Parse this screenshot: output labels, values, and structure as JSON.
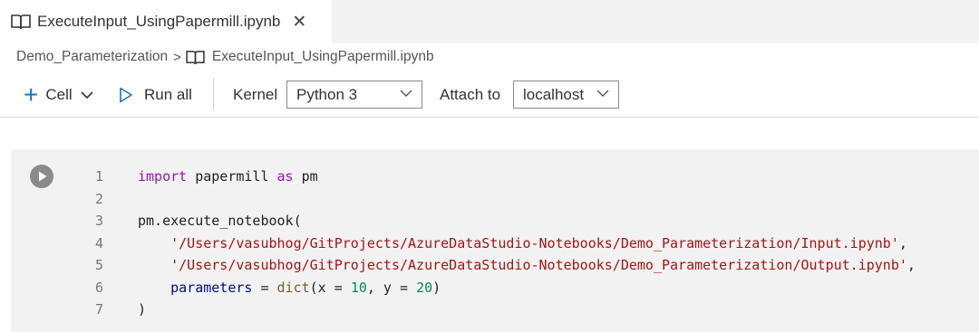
{
  "tab": {
    "title": "ExecuteInput_UsingPapermill.ipynb",
    "close_icon": "close-icon",
    "icon": "notebook-icon"
  },
  "breadcrumb": {
    "folder": "Demo_Parameterization",
    "separator": ">",
    "file": "ExecuteInput_UsingPapermill.ipynb"
  },
  "toolbar": {
    "cell_label": "Cell",
    "run_all_label": "Run all",
    "kernel_label": "Kernel",
    "kernel_value": "Python 3",
    "attach_label": "Attach to",
    "attach_value": "localhost"
  },
  "colors": {
    "accent": "#1a73c8",
    "keyword": "#9b14b0",
    "string": "#a31515",
    "number": "#098658"
  },
  "cell": {
    "line_numbers": [
      "1",
      "2",
      "3",
      "4",
      "5",
      "6",
      "7"
    ],
    "lines": [
      {
        "tokens": [
          [
            "kw",
            "import"
          ],
          [
            "t",
            " papermill "
          ],
          [
            "kw",
            "as"
          ],
          [
            "t",
            " pm"
          ]
        ]
      },
      {
        "tokens": []
      },
      {
        "tokens": [
          [
            "t",
            "pm.execute_notebook("
          ]
        ]
      },
      {
        "tokens": [
          [
            "t",
            "    "
          ],
          [
            "str",
            "'/Users/vasubhog/GitProjects/AzureDataStudio-Notebooks/Demo_Parameterization/Input.ipynb'"
          ],
          [
            "t",
            ","
          ]
        ]
      },
      {
        "tokens": [
          [
            "t",
            "    "
          ],
          [
            "str",
            "'/Users/vasubhog/GitProjects/AzureDataStudio-Notebooks/Demo_Parameterization/Output.ipynb'"
          ],
          [
            "t",
            ","
          ]
        ]
      },
      {
        "tokens": [
          [
            "t",
            "    "
          ],
          [
            "param",
            "parameters"
          ],
          [
            "t",
            " = "
          ],
          [
            "fn-dict",
            "dict"
          ],
          [
            "t",
            "(x = "
          ],
          [
            "num",
            "10"
          ],
          [
            "t",
            ", y = "
          ],
          [
            "num",
            "20"
          ],
          [
            "t",
            ")"
          ]
        ]
      },
      {
        "tokens": [
          [
            "t",
            ")"
          ]
        ]
      }
    ]
  }
}
